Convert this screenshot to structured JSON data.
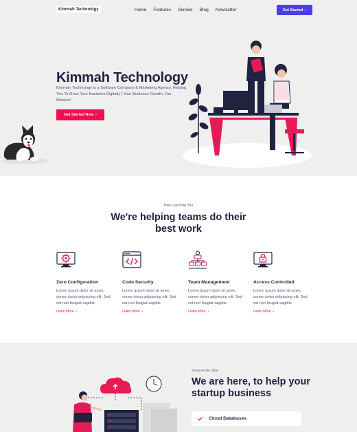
{
  "nav": {
    "logo": "Kimmah Technology",
    "links": [
      "Home",
      "Features",
      "Service",
      "Blog",
      "Newsletter"
    ],
    "cta": "Get Started"
  },
  "hero": {
    "title": "Kimmah Technology",
    "description": "Kimmah Technology is a Software Company & Marketing Agency, Helping You To Grow Your Business Digitally | Your Business Growth, Our Mission!",
    "cta": "Get Started Now"
  },
  "help": {
    "eyebrow": "How Can Help You",
    "title": "We're helping teams do their best work",
    "features": [
      {
        "name": "Zero Configuration",
        "icon": "settings-monitor-icon",
        "desc": "Lorem Ipsum dolor sit amet, conse ctetur adipiscing elit. Sed est non feugiat sagittis.",
        "link": "Learn More"
      },
      {
        "name": "Code Security",
        "icon": "code-window-icon",
        "desc": "Lorem Ipsum dolor sit amet, conse ctetur adipiscing elit. Sed est non feugiat sagittis.",
        "link": "Learn More"
      },
      {
        "name": "Team Management",
        "icon": "team-hierarchy-icon",
        "desc": "Lorem Ipsum dolor sit amet, conse ctetur adipiscing elit. Sed est non feugiat sagittis.",
        "link": "Learn More"
      },
      {
        "name": "Access Controlled",
        "icon": "lock-monitor-icon",
        "desc": "Lorem Ipsum dolor sit amet, conse ctetur adipiscing elit. Sed est non feugiat sagittis.",
        "link": "Learn More"
      }
    ]
  },
  "startup": {
    "eyebrow": "Services We Offer",
    "title": "We are here, to help your startup business",
    "items": [
      "Cloud Databases"
    ]
  },
  "colors": {
    "primary": "#4b3ee8",
    "accent": "#f0104f",
    "dark": "#1f2340"
  }
}
